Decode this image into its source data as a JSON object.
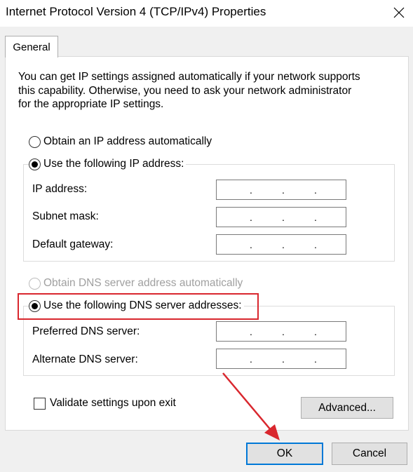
{
  "window": {
    "title": "Internet Protocol Version 4 (TCP/IPv4) Properties"
  },
  "tabs": [
    {
      "label": "General"
    }
  ],
  "description": {
    "line1": "You can get IP settings assigned automatically if your network supports",
    "line2": "this capability. Otherwise, you need to ask your network administrator",
    "line3": "for the appropriate IP settings."
  },
  "ip": {
    "auto_label": "Obtain an IP address automatically",
    "manual_label": "Use the following IP address:",
    "selected": "manual",
    "fields": [
      {
        "label": "IP address:",
        "value": ""
      },
      {
        "label": "Subnet mask:",
        "value": ""
      },
      {
        "label": "Default gateway:",
        "value": ""
      }
    ]
  },
  "dns": {
    "auto_label": "Obtain DNS server address automatically",
    "manual_label": "Use the following DNS server addresses:",
    "selected": "manual",
    "fields": [
      {
        "label": "Preferred DNS server:",
        "value": ""
      },
      {
        "label": "Alternate DNS server:",
        "value": ""
      }
    ]
  },
  "validate": {
    "label": "Validate settings upon exit",
    "checked": false
  },
  "buttons": {
    "advanced": "Advanced...",
    "ok": "OK",
    "cancel": "Cancel"
  },
  "colors": {
    "highlight": "#d9272e",
    "arrow": "#d9272e",
    "default_button_border": "#0078d7"
  },
  "icons": {
    "close": "close-icon"
  }
}
